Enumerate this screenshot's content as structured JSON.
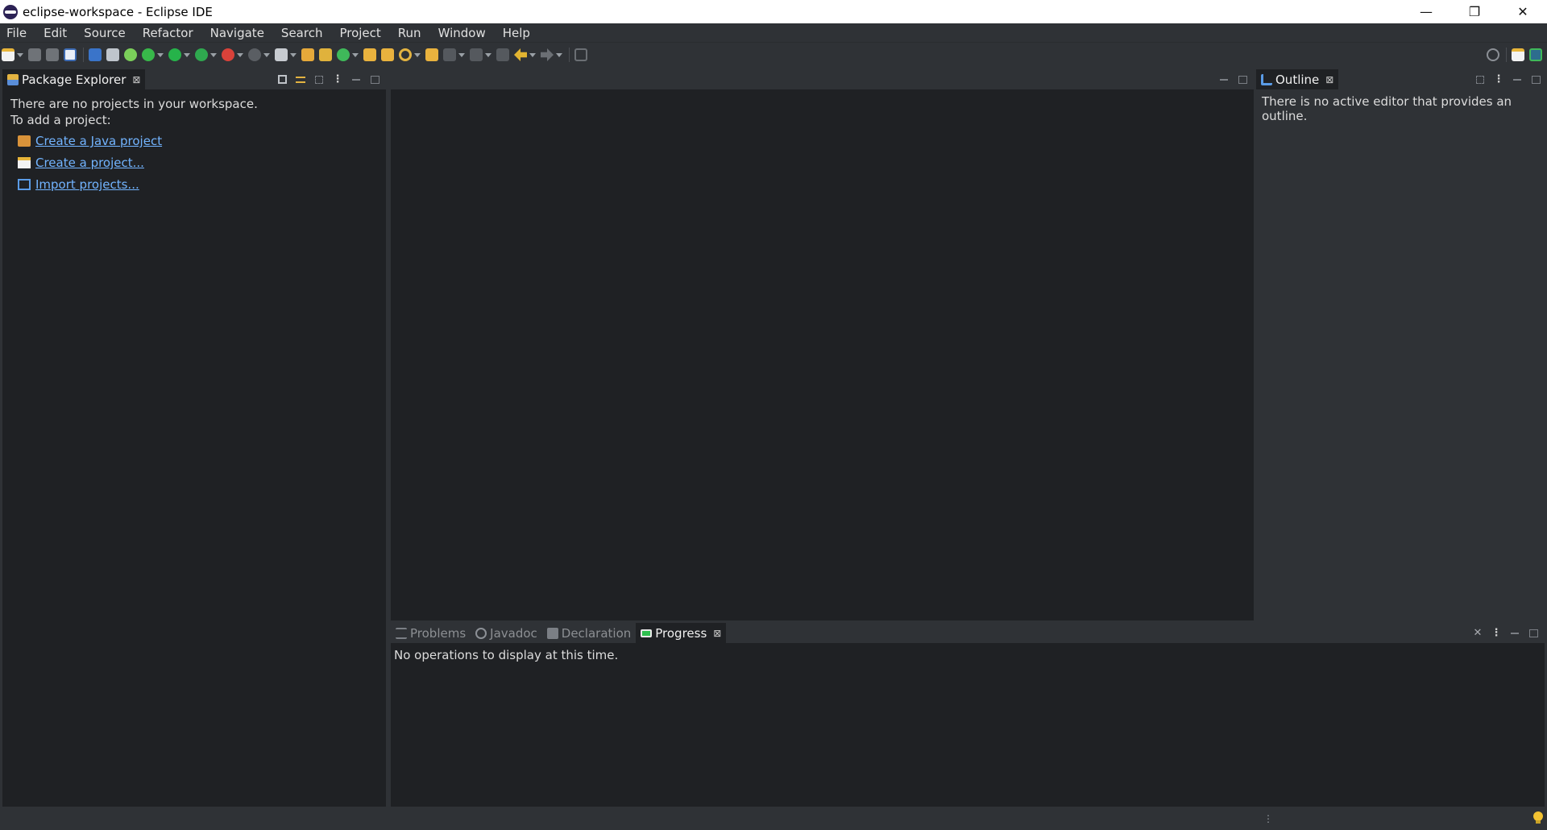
{
  "window": {
    "title": "eclipse-workspace - Eclipse IDE",
    "minimize_glyph": "—",
    "restore_glyph": "❐",
    "close_glyph": "✕"
  },
  "menu": [
    "File",
    "Edit",
    "Source",
    "Refactor",
    "Navigate",
    "Search",
    "Project",
    "Run",
    "Window",
    "Help"
  ],
  "package_explorer": {
    "tab_label": "Package Explorer",
    "message_line1": "There are no projects in your workspace.",
    "message_line2": "To add a project:",
    "links": [
      {
        "label": "Create a Java project",
        "icon": "java-project-folder-icon"
      },
      {
        "label": "Create a project...",
        "icon": "new-project-icon"
      },
      {
        "label": "Import projects...",
        "icon": "import-icon"
      }
    ]
  },
  "outline": {
    "tab_label": "Outline",
    "message": "There is no active editor that provides an outline."
  },
  "bottom_panel": {
    "tabs": [
      {
        "label": "Problems",
        "active": false
      },
      {
        "label": "Javadoc",
        "active": false
      },
      {
        "label": "Declaration",
        "active": false
      },
      {
        "label": "Progress",
        "active": true
      }
    ],
    "message": "No operations to display at this time."
  },
  "glyphs": {
    "close_tab": "⊠",
    "view_menu": "⋮",
    "remove_all": "✕",
    "status_grip": "⋮"
  },
  "colors": {
    "background": "#2f3236",
    "panel": "#1f2124",
    "link": "#72b4ff",
    "text": "#dcdcdc"
  }
}
